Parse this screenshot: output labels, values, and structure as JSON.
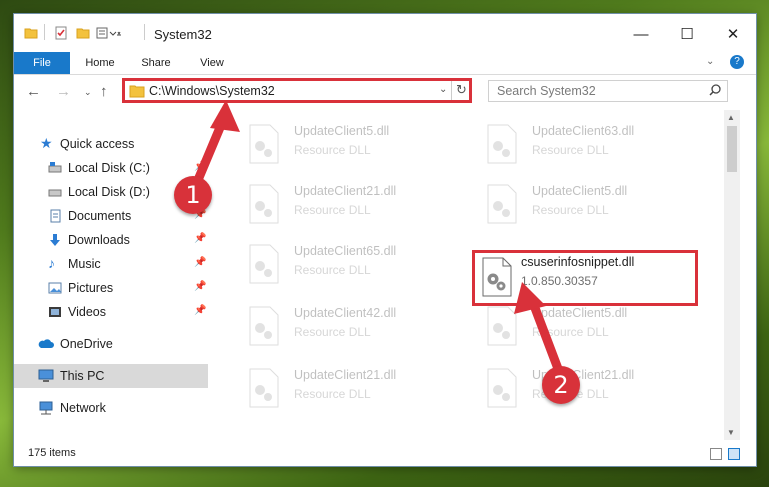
{
  "window": {
    "title": "System32"
  },
  "ribbon": {
    "tabs": [
      "File",
      "Home",
      "Share",
      "View"
    ]
  },
  "address": {
    "path": "C:\\Windows\\System32"
  },
  "search": {
    "placeholder": "Search System32"
  },
  "nav": {
    "items": [
      {
        "label": "Quick access",
        "icon": "star-icon",
        "pinned": false
      },
      {
        "label": "Local Disk (C:)",
        "icon": "drive-icon",
        "pinned": true
      },
      {
        "label": "Local Disk (D:)",
        "icon": "drive-icon",
        "pinned": false
      },
      {
        "label": "Documents",
        "icon": "documents-icon",
        "pinned": true
      },
      {
        "label": "Downloads",
        "icon": "download-icon",
        "pinned": true
      },
      {
        "label": "Music",
        "icon": "music-icon",
        "pinned": true
      },
      {
        "label": "Pictures",
        "icon": "pictures-icon",
        "pinned": true
      },
      {
        "label": "Videos",
        "icon": "videos-icon",
        "pinned": true
      },
      {
        "label": "OneDrive",
        "icon": "cloud-icon",
        "pinned": false
      },
      {
        "label": "This PC",
        "icon": "computer-icon",
        "pinned": false,
        "selected": true
      },
      {
        "label": "Network",
        "icon": "network-icon",
        "pinned": false
      }
    ]
  },
  "files": [
    {
      "name": "UpdateClient5.dll",
      "desc": "Resource DLL",
      "faded": true
    },
    {
      "name": "UpdateClient63.dll",
      "desc": "Resource DLL",
      "faded": true
    },
    {
      "name": "UpdateClient21.dll",
      "desc": "Resource DLL",
      "faded": true
    },
    {
      "name": "UpdateClient5.dll",
      "desc": "Resource DLL",
      "faded": true
    },
    {
      "name": "UpdateClient65.dll",
      "desc": "Resource DLL",
      "faded": true
    },
    {
      "name": "csuserinfosnippet.dll",
      "desc": "1.0.850.30357",
      "faded": false
    },
    {
      "name": "UpdateClient42.dll",
      "desc": "Resource DLL",
      "faded": true
    },
    {
      "name": "UpdateClient5.dll",
      "desc": "Resource DLL",
      "faded": true
    },
    {
      "name": "UpdateClient21.dll",
      "desc": "Resource DLL",
      "faded": true
    },
    {
      "name": "UpdateClient21.dll",
      "desc": "Resource DLL",
      "faded": true
    }
  ],
  "status": {
    "count": "175 items"
  },
  "callouts": [
    "1",
    "2"
  ],
  "colors": {
    "accent": "#1979ca",
    "annotation": "#d9313a"
  }
}
